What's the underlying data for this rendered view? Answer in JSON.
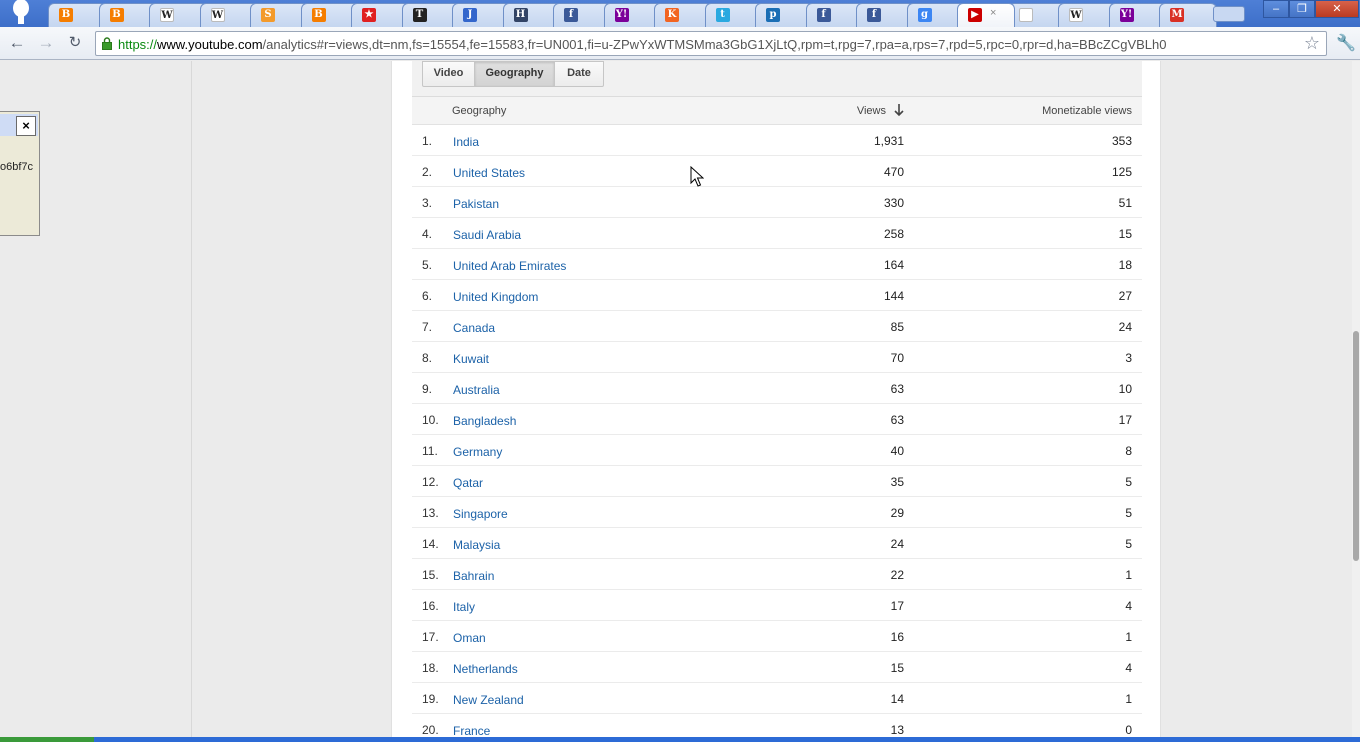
{
  "browser": {
    "tabs": [
      {
        "icon": "blogger-icon",
        "color": "#f57d00",
        "glyph": "B"
      },
      {
        "icon": "blogger-icon",
        "color": "#f57d00",
        "glyph": "B"
      },
      {
        "icon": "wikipedia-icon",
        "color": "#ffffff",
        "glyph": "W"
      },
      {
        "icon": "wikipedia-icon",
        "color": "#ffffff",
        "glyph": "W"
      },
      {
        "icon": "blogger-orange-icon",
        "color": "#f39a2b",
        "glyph": "S"
      },
      {
        "icon": "blogger-icon",
        "color": "#f57d00",
        "glyph": "B"
      },
      {
        "icon": "star-icon",
        "color": "#e02020",
        "glyph": "★"
      },
      {
        "icon": "tt-icon",
        "color": "#222222",
        "glyph": "T"
      },
      {
        "icon": "swoosh-icon",
        "color": "#3366cc",
        "glyph": "J"
      },
      {
        "icon": "h-icon",
        "color": "#334466",
        "glyph": "H"
      },
      {
        "icon": "facebook-icon",
        "color": "#3b5998",
        "glyph": "f"
      },
      {
        "icon": "yahoo-icon",
        "color": "#7b0099",
        "glyph": "Y!"
      },
      {
        "icon": "k-icon",
        "color": "#f26522",
        "glyph": "K"
      },
      {
        "icon": "twitter-icon",
        "color": "#2aa9e0",
        "glyph": "t"
      },
      {
        "icon": "p-icon",
        "color": "#1a6eb5",
        "glyph": "p"
      },
      {
        "icon": "facebook-icon",
        "color": "#3b5998",
        "glyph": "f"
      },
      {
        "icon": "facebook-icon",
        "color": "#3b5998",
        "glyph": "f"
      },
      {
        "icon": "google-icon",
        "color": "#3c86f3",
        "glyph": "g"
      },
      {
        "icon": "youtube-icon",
        "color": "#cc0000",
        "glyph": "▶",
        "active": true
      },
      {
        "icon": "page-icon",
        "color": "#ffffff",
        "glyph": ""
      },
      {
        "icon": "wikipedia-icon",
        "color": "#ffffff",
        "glyph": "W"
      },
      {
        "icon": "yahoo-icon",
        "color": "#7b0099",
        "glyph": "Y!"
      },
      {
        "icon": "gmail-icon",
        "color": "#d93025",
        "glyph": "M"
      }
    ],
    "url": {
      "scheme": "https://",
      "host": "www.youtube.com",
      "path": "/analytics#r=views,dt=nm,fs=15554,fe=15583,fr=UN001,fi=u-ZPwYxWTMSMma3GbG1XjLtQ,rpm=t,rpg=7,rpa=a,rps=7,rpd=5,rpc=0,rpr=d,ha=BBcZCgVBLh0"
    }
  },
  "popup": {
    "close_label": "×",
    "text": "o6bf7c"
  },
  "report": {
    "tabs": [
      {
        "label": "Video",
        "selected": false
      },
      {
        "label": "Geography",
        "selected": true
      },
      {
        "label": "Date",
        "selected": false
      }
    ],
    "columns": {
      "geography": "Geography",
      "views": "Views",
      "monetizable": "Monetizable views"
    },
    "rows": [
      {
        "rank": "1.",
        "country": "India",
        "views": "1,931",
        "monetizable": "353"
      },
      {
        "rank": "2.",
        "country": "United States",
        "views": "470",
        "monetizable": "125"
      },
      {
        "rank": "3.",
        "country": "Pakistan",
        "views": "330",
        "monetizable": "51"
      },
      {
        "rank": "4.",
        "country": "Saudi Arabia",
        "views": "258",
        "monetizable": "15"
      },
      {
        "rank": "5.",
        "country": "United Arab Emirates",
        "views": "164",
        "monetizable": "18"
      },
      {
        "rank": "6.",
        "country": "United Kingdom",
        "views": "144",
        "monetizable": "27"
      },
      {
        "rank": "7.",
        "country": "Canada",
        "views": "85",
        "monetizable": "24"
      },
      {
        "rank": "8.",
        "country": "Kuwait",
        "views": "70",
        "monetizable": "3"
      },
      {
        "rank": "9.",
        "country": "Australia",
        "views": "63",
        "monetizable": "10"
      },
      {
        "rank": "10.",
        "country": "Bangladesh",
        "views": "63",
        "monetizable": "17"
      },
      {
        "rank": "11.",
        "country": "Germany",
        "views": "40",
        "monetizable": "8"
      },
      {
        "rank": "12.",
        "country": "Qatar",
        "views": "35",
        "monetizable": "5"
      },
      {
        "rank": "13.",
        "country": "Singapore",
        "views": "29",
        "monetizable": "5"
      },
      {
        "rank": "14.",
        "country": "Malaysia",
        "views": "24",
        "monetizable": "5"
      },
      {
        "rank": "15.",
        "country": "Bahrain",
        "views": "22",
        "monetizable": "1"
      },
      {
        "rank": "16.",
        "country": "Italy",
        "views": "17",
        "monetizable": "4"
      },
      {
        "rank": "17.",
        "country": "Oman",
        "views": "16",
        "monetizable": "1"
      },
      {
        "rank": "18.",
        "country": "Netherlands",
        "views": "15",
        "monetizable": "4"
      },
      {
        "rank": "19.",
        "country": "New Zealand",
        "views": "14",
        "monetizable": "1"
      },
      {
        "rank": "20.",
        "country": "France",
        "views": "13",
        "monetizable": "0"
      }
    ]
  },
  "colors": {
    "link": "#1c62a8",
    "tabstrip": "#3d6fc9",
    "secure_scheme": "#0a8a10"
  }
}
